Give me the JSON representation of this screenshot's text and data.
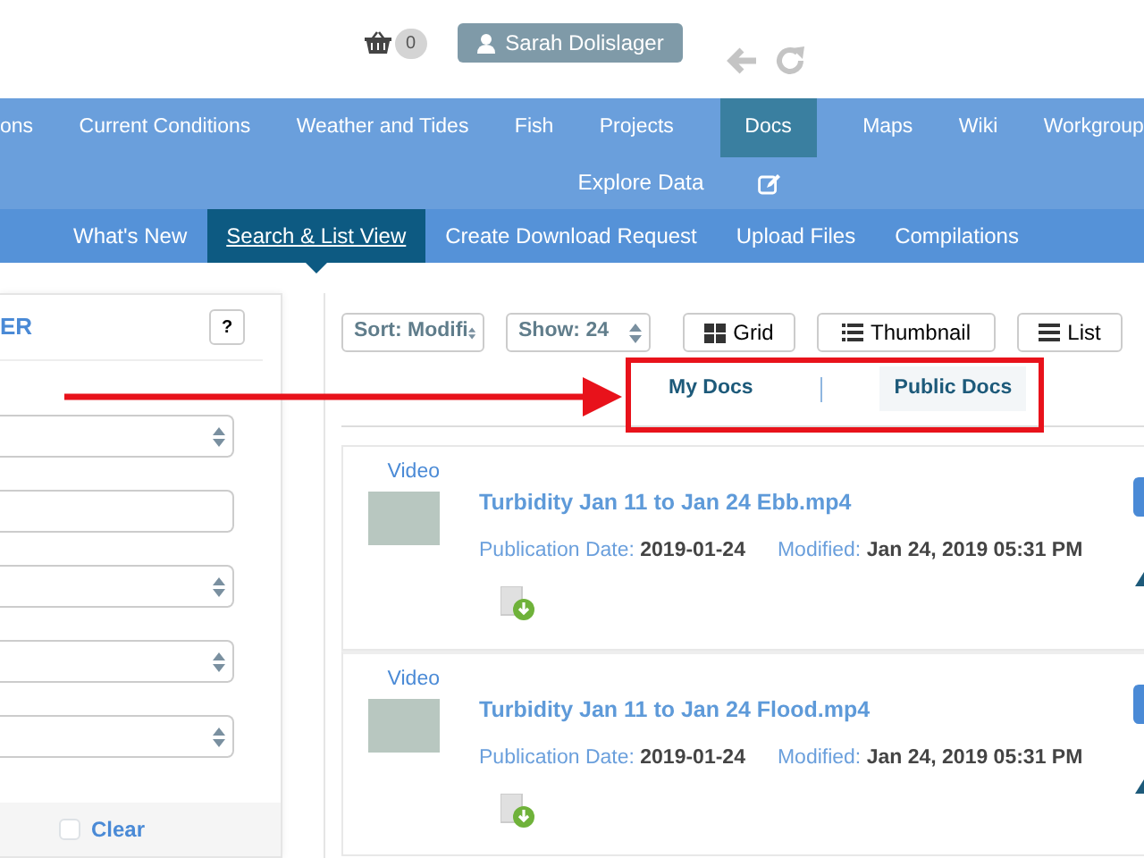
{
  "header": {
    "cart_count": "0",
    "user_button": "Sarah Dolislager"
  },
  "main_nav": [
    {
      "label": "ons",
      "selected": false
    },
    {
      "label": "Current Conditions",
      "selected": false
    },
    {
      "label": "Weather and Tides",
      "selected": false
    },
    {
      "label": "Fish",
      "selected": false
    },
    {
      "label": "Projects",
      "selected": false
    },
    {
      "label": "Docs",
      "selected": true
    },
    {
      "label": "Maps",
      "selected": false
    },
    {
      "label": "Wiki",
      "selected": false
    },
    {
      "label": "Workgroup",
      "selected": false
    }
  ],
  "nav_row2": {
    "label": "Explore Data"
  },
  "sub_nav": [
    {
      "label": "What's New",
      "selected": false
    },
    {
      "label": "Search & List View",
      "selected": true
    },
    {
      "label": "Create Download Request",
      "selected": false
    },
    {
      "label": "Upload Files",
      "selected": false
    },
    {
      "label": "Compilations",
      "selected": false
    }
  ],
  "filter_panel": {
    "title": "ER",
    "help": "?",
    "fields": [
      {
        "kind": "select"
      },
      {
        "kind": "input"
      },
      {
        "kind": "select"
      },
      {
        "kind": "select"
      },
      {
        "kind": "select"
      }
    ],
    "clear": "Clear",
    "clear_checked": false
  },
  "toolbar": {
    "sort": "Sort: Modifi",
    "show": "Show: 24",
    "views": [
      {
        "label": "Grid",
        "kind": "grid"
      },
      {
        "label": "Thumbnail",
        "kind": "thumbnail"
      },
      {
        "label": "List",
        "kind": "list"
      }
    ]
  },
  "doc_tabs": [
    {
      "label": "My Docs",
      "selected": false
    },
    {
      "label": "Public Docs",
      "selected": true
    }
  ],
  "documents": [
    {
      "type": "Video",
      "title": "Turbidity Jan 11 to Jan 24 Ebb.mp4",
      "publication_label": "Publication Date:",
      "publication_date": "2019-01-24",
      "modified_label": "Modified:",
      "modified": "Jan 24, 2019 05:31 PM"
    },
    {
      "type": "Video",
      "title": "Turbidity Jan 11 to Jan 24 Flood.mp4",
      "publication_label": "Publication Date:",
      "publication_date": "2019-01-24",
      "modified_label": "Modified:",
      "modified": "Jan 24, 2019 05:31 PM"
    }
  ]
}
